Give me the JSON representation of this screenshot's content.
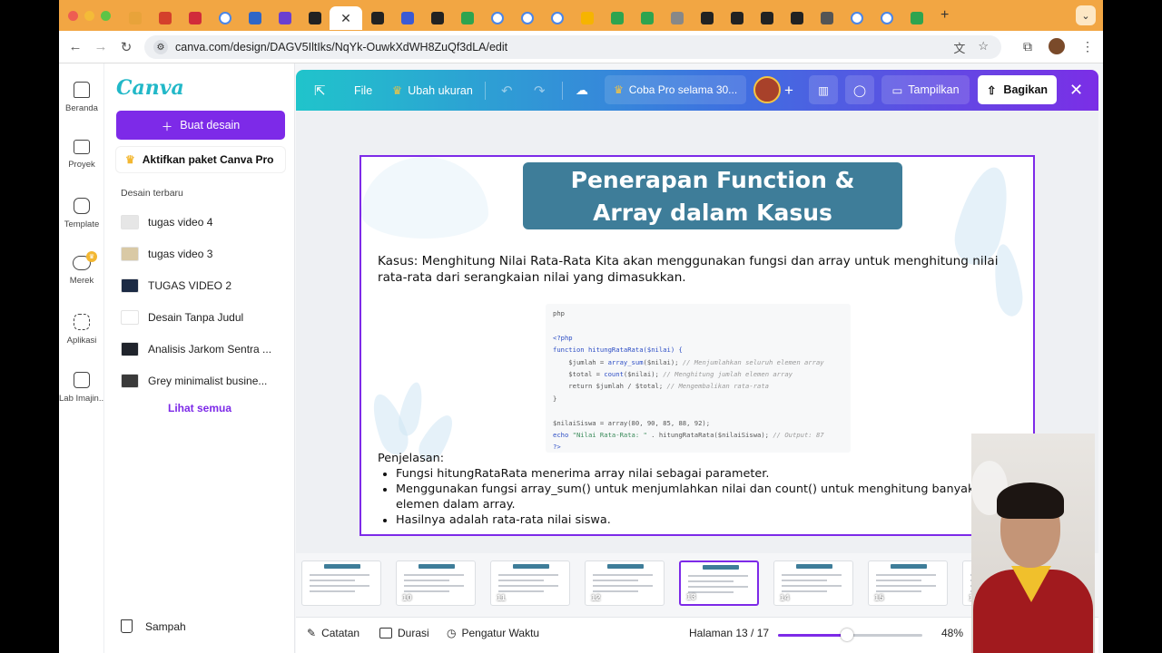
{
  "browser": {
    "url": "canva.com/design/DAGV5IltIks/NqYk-OuwkXdWH8ZuQf3dLA/edit",
    "tabs": [
      {
        "icon": "clock-tab-icon",
        "color": "#e8a33a"
      },
      {
        "icon": "red-tab-icon",
        "color": "#d4402b"
      },
      {
        "icon": "red-s-tab-icon",
        "color": "#d12b3a"
      },
      {
        "icon": "google-tab-icon",
        "color": "#ffffff"
      },
      {
        "icon": "contact-tab-icon",
        "color": "#2f66c7"
      },
      {
        "icon": "heart-tab-icon",
        "color": "#6b3fd1"
      },
      {
        "icon": "dots-tab-icon",
        "color": "#222222"
      },
      {
        "icon": "dots-tab-icon",
        "color": "#222222"
      },
      {
        "icon": "shield-tab-icon",
        "color": "#3b5ad4"
      },
      {
        "icon": "openai-tab-icon",
        "color": "#222222"
      },
      {
        "icon": "plus-green-tab-icon",
        "color": "#2ea44f"
      },
      {
        "icon": "google-tab-icon",
        "color": "#ffffff"
      },
      {
        "icon": "google-tab-icon",
        "color": "#ffffff"
      },
      {
        "icon": "google-tab-icon",
        "color": "#ffffff"
      },
      {
        "icon": "drive-tab-icon",
        "color": "#f6b400"
      },
      {
        "icon": "plus-green-tab-icon",
        "color": "#2ea44f"
      },
      {
        "icon": "plus-green-tab-icon",
        "color": "#2ea44f"
      },
      {
        "icon": "apple-tab-icon",
        "color": "#888888"
      },
      {
        "icon": "dots-tab-icon",
        "color": "#222222"
      },
      {
        "icon": "dots-tab-icon",
        "color": "#222222"
      },
      {
        "icon": "dots-tab-icon",
        "color": "#222222"
      },
      {
        "icon": "bolt-tab-icon",
        "color": "#222222"
      },
      {
        "icon": "chrome-tab-icon",
        "color": "#555555"
      },
      {
        "icon": "google-tab-icon",
        "color": "#ffffff"
      },
      {
        "icon": "google-tab-icon",
        "color": "#ffffff"
      },
      {
        "icon": "sheet-tab-icon",
        "color": "#2ea44f"
      }
    ]
  },
  "rail": {
    "items": [
      {
        "label": "Beranda",
        "icon": "home-icon"
      },
      {
        "label": "Proyek",
        "icon": "folder-icon"
      },
      {
        "label": "Template",
        "icon": "template-icon"
      },
      {
        "label": "Merek",
        "icon": "brand-icon"
      },
      {
        "label": "Aplikasi",
        "icon": "apps-icon"
      },
      {
        "label": "Lab Imajin...",
        "icon": "magic-lab-icon"
      }
    ]
  },
  "panel": {
    "logo": "Canva",
    "create_label": "Buat desain",
    "pro_label": "Aktifkan paket Canva Pro",
    "recent_title": "Desain terbaru",
    "recent": [
      {
        "name": "tugas video 4",
        "thumb_color": "#e6e6e6"
      },
      {
        "name": "tugas video 3",
        "thumb_color": "#d9c9a5"
      },
      {
        "name": "TUGAS VIDEO 2",
        "thumb_color": "#1b2a44"
      },
      {
        "name": "Desain Tanpa Judul",
        "thumb_color": "#ffffff"
      },
      {
        "name": "Analisis Jarkom Sentra ...",
        "thumb_color": "#20242c"
      },
      {
        "name": "Grey minimalist busine...",
        "thumb_color": "#3a3a3a"
      }
    ],
    "see_all": "Lihat semua",
    "trash": "Sampah"
  },
  "topbar": {
    "file": "File",
    "resize": "Ubah ukuran",
    "pro_trial": "Coba Pro selama 30...",
    "present": "Tampilkan",
    "share": "Bagikan"
  },
  "slide": {
    "title_line1": "Penerapan Function &",
    "title_line2": "Array dalam Kasus",
    "case_text": "Kasus: Menghitung Nilai Rata-Rata Kita akan menggunakan fungsi dan array untuk menghitung nilai rata-rata dari serangkaian nilai yang dimasukkan.",
    "code": {
      "lang": "php",
      "open": "<?php",
      "l1_kw": "function",
      "l1_fn": " hitungRataRata($nilai) {",
      "l2": "    $jumlah = ",
      "l2_fn": "array_sum",
      "l2_rest": "($nilai); ",
      "l2_cm": "// Menjumlahkan seluruh elemen array",
      "l3": "    $total = ",
      "l3_fn": "count",
      "l3_rest": "($nilai); ",
      "l3_cm": "// Menghitung jumlah elemen array",
      "l4": "    return $jumlah / $total; ",
      "l4_cm": "// Mengembalikan rata-rata",
      "l5": "}",
      "l6": "$nilaiSiswa = array(80, 90, 85, 88, 92);",
      "l7_a": "echo ",
      "l7_str": "\"Nilai Rata-Rata: \"",
      "l7_b": " . hitungRataRata($nilaiSiswa); ",
      "l7_cm": "// Output: 87",
      "close": "?>"
    },
    "explain_title": "Penjelasan:",
    "bullets": [
      "Fungsi hitungRataRata menerima array nilai sebagai parameter.",
      "Menggunakan fungsi array_sum() untuk menjumlahkan nilai dan count() untuk menghitung banyaknya elemen dalam array.",
      "Hasilnya adalah rata-rata nilai siswa."
    ]
  },
  "thumbnails": [
    {
      "num": ""
    },
    {
      "num": "10"
    },
    {
      "num": "11"
    },
    {
      "num": "12"
    },
    {
      "num": "13",
      "selected": true
    },
    {
      "num": "14"
    },
    {
      "num": "15"
    },
    {
      "num": "16"
    }
  ],
  "bottombar": {
    "notes": "Catatan",
    "duration": "Durasi",
    "timer": "Pengatur Waktu",
    "page": "Halaman 13 / 17",
    "zoom": "48%",
    "zoom_fraction": 0.48
  },
  "colors": {
    "accent": "#7d2ae8",
    "title_bg": "#3e7d99",
    "tabbar": "#f2a643"
  }
}
